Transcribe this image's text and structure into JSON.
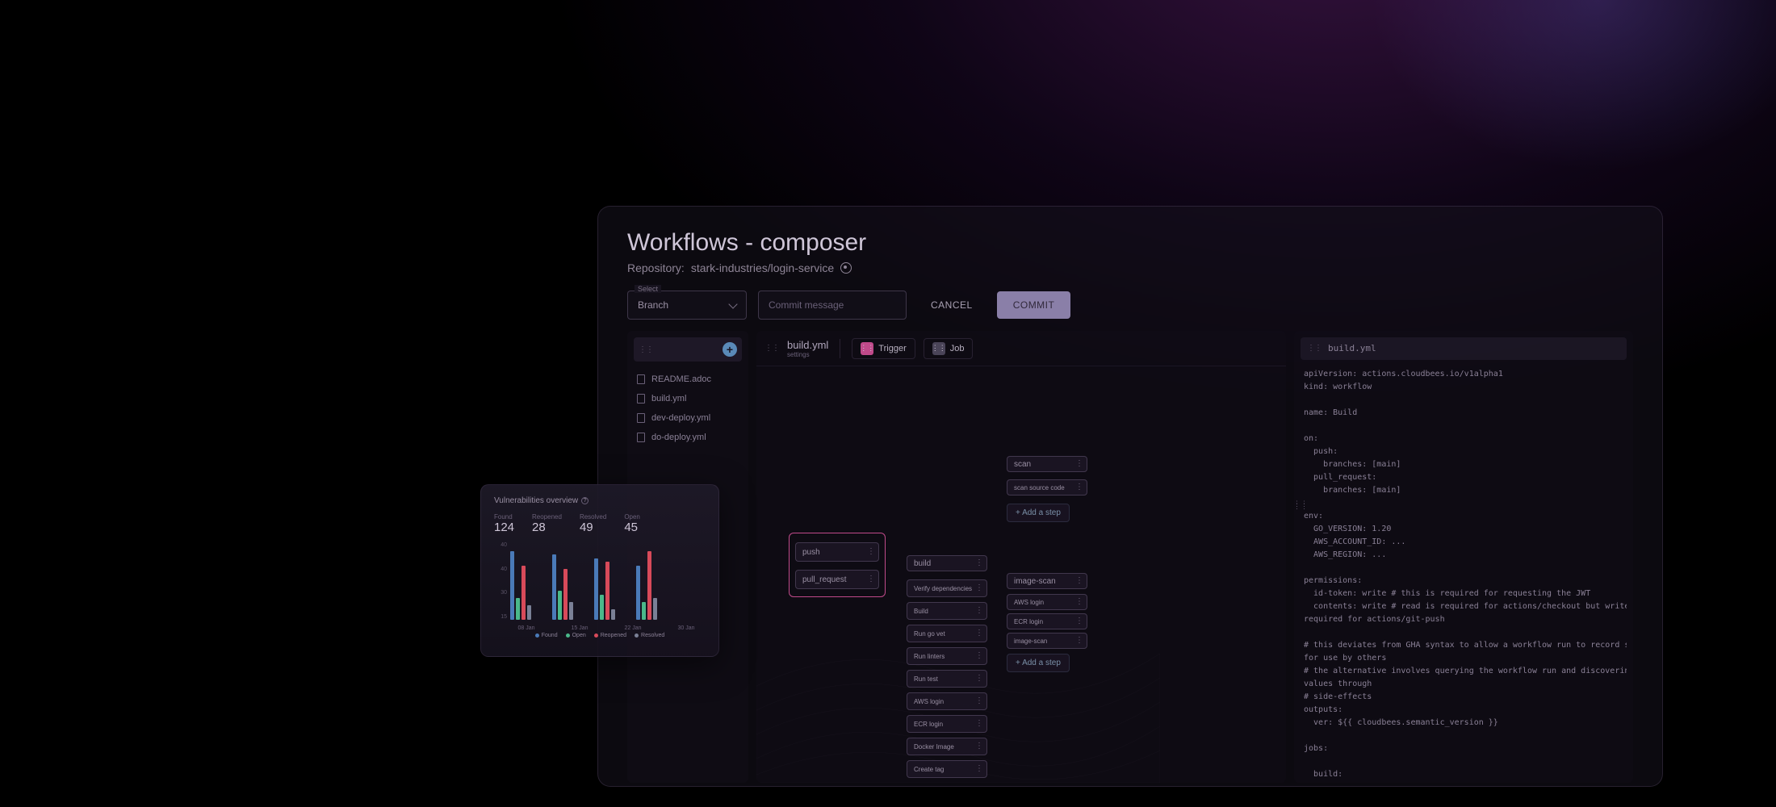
{
  "page": {
    "title": "Workflows - composer",
    "repo_label": "Repository:",
    "repo_value": "stark-industries/login-service"
  },
  "controls": {
    "select_label": "Select",
    "select_value": "Branch",
    "commit_placeholder": "Commit message",
    "cancel": "CANCEL",
    "commit": "COMMIT"
  },
  "files": [
    "README.adoc",
    "build.yml",
    "dev-deploy.yml",
    "do-deploy.yml"
  ],
  "canvas": {
    "file": "build.yml",
    "file_sub": "settings",
    "trigger_label": "Trigger",
    "job_label": "Job",
    "triggers": [
      "push",
      "pull_request"
    ],
    "build_header": "build",
    "build_steps": [
      "Verify dependencies",
      "Build",
      "Run go vet",
      "Run linters",
      "Run test",
      "AWS login",
      "ECR login",
      "Docker Image",
      "Create tag"
    ],
    "scan_header": "scan",
    "scan_sub": "scan source code",
    "add_step": "+ Add a step",
    "image_header": "image-scan",
    "image_steps": [
      "AWS login",
      "ECR login",
      "image-scan"
    ]
  },
  "code": {
    "tab": "build.yml",
    "body": "apiVersion: actions.cloudbees.io/v1alpha1\nkind: workflow\n\nname: Build\n\non:\n  push:\n    branches: [main]\n  pull_request:\n    branches: [main]\n\nenv:\n  GO_VERSION: 1.20\n  AWS_ACCOUNT_ID: ...\n  AWS_REGION: ...\n\npermissions:\n  id-token: write # this is required for requesting the JWT\n  contents: write # read is required for actions/checkout but write is\nrequired for actions/git-push\n\n# this deviates from GHA syntax to allow a workflow run to record state\nfor use by others\n# the alternative involves querying the workflow run and discovering\nvalues through\n# side-effects\noutputs:\n  ver: ${{ cloudbees.semantic_version }}\n\njobs:\n\n  build:"
  },
  "vuln": {
    "title": "Vulnerabilities overview",
    "stats": [
      {
        "label": "Found",
        "value": "124"
      },
      {
        "label": "Reopened",
        "value": "28"
      },
      {
        "label": "Resolved",
        "value": "49"
      },
      {
        "label": "Open",
        "value": "45"
      }
    ],
    "legend": [
      "Found",
      "Open",
      "Reopened",
      "Resolved"
    ]
  },
  "colors": {
    "found": "#4a7ab8",
    "open": "#4ab88a",
    "reopened": "#d84a5a",
    "resolved": "#7a8096"
  },
  "chart_data": {
    "type": "bar",
    "title": "Vulnerabilities overview",
    "ylabel": "",
    "xlabel": "",
    "ylim": [
      0,
      40
    ],
    "yticks": [
      40,
      40,
      30,
      15
    ],
    "categories": [
      "08 Jan",
      "15 Jan",
      "22 Jan",
      "30 Jan"
    ],
    "series": [
      {
        "name": "Found",
        "color": "#4a7ab8",
        "values": [
          38,
          36,
          34,
          30
        ]
      },
      {
        "name": "Open",
        "color": "#4ab88a",
        "values": [
          12,
          16,
          14,
          10
        ]
      },
      {
        "name": "Reopened",
        "color": "#d84a5a",
        "values": [
          30,
          28,
          32,
          38
        ]
      },
      {
        "name": "Resolved",
        "color": "#7a8096",
        "values": [
          8,
          10,
          6,
          12
        ]
      }
    ]
  }
}
